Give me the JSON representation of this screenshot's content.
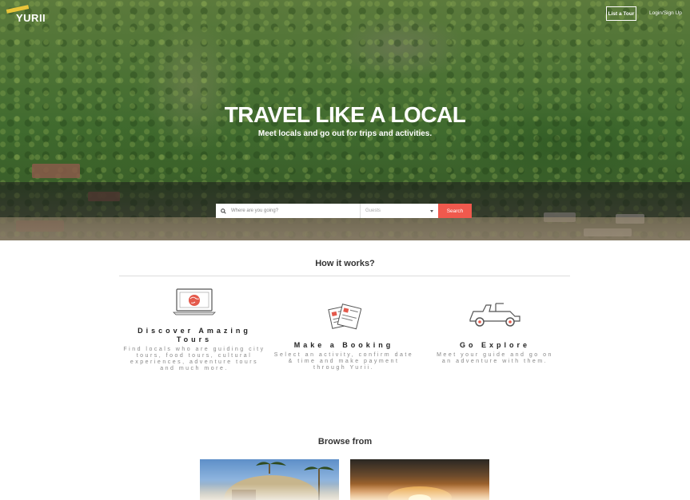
{
  "header": {
    "logo_text": "YURII",
    "list_tour_label": "List a Tour",
    "login_label": "Login/Sign Up"
  },
  "hero": {
    "title": "TRAVEL LIKE A LOCAL",
    "subtitle": "Meet locals and go out for trips and activities."
  },
  "search": {
    "placeholder": "Where are you going?",
    "guests_placeholder": "Guests",
    "button_label": "Search"
  },
  "how_it_works": {
    "title": "How it works?",
    "steps": [
      {
        "icon": "laptop-globe-icon",
        "title": "Discover Amazing Tours",
        "desc": "Find locals who are guiding city tours, food tours, cultural experiences, adventure tours and much more."
      },
      {
        "icon": "booking-tickets-icon",
        "title": "Make a Booking",
        "desc": "Select an activity, confirm date & time and make payment through Yurii."
      },
      {
        "icon": "jeep-icon",
        "title": "Go Explore",
        "desc": "Meet your guide and go on an adventure with them."
      }
    ]
  },
  "browse": {
    "title": "Browse from"
  },
  "colors": {
    "accent": "#f0594d",
    "logo_yellow": "#e8c53a"
  }
}
